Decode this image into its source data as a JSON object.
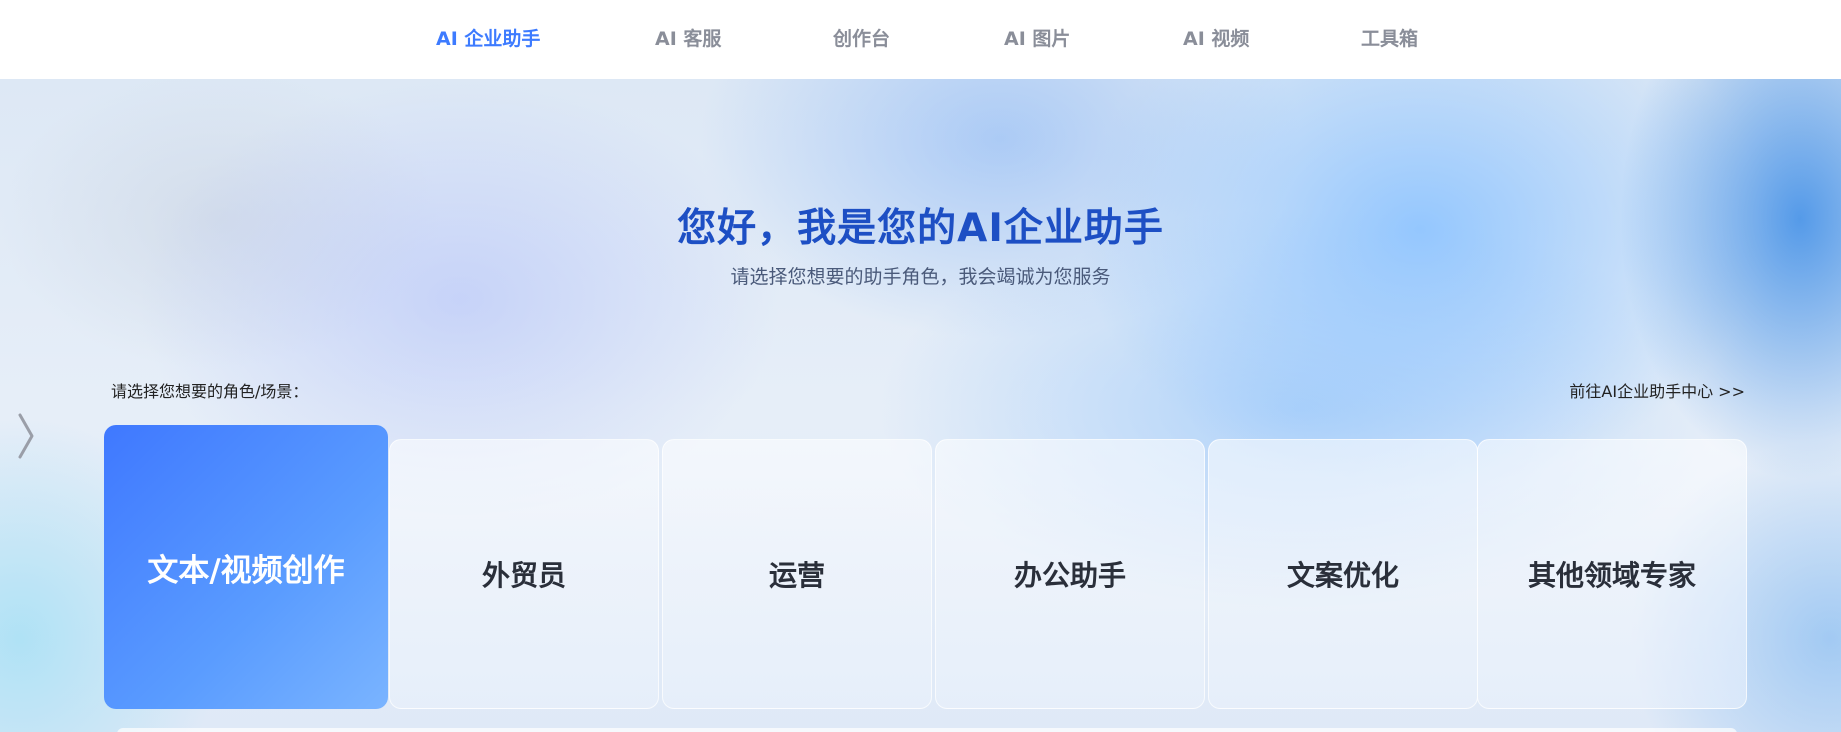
{
  "nav": {
    "items": [
      {
        "label": "AI 企业助手",
        "active": true
      },
      {
        "label": "AI 客服",
        "active": false
      },
      {
        "label": "创作台",
        "active": false
      },
      {
        "label": "AI 图片",
        "active": false
      },
      {
        "label": "AI 视频",
        "active": false
      },
      {
        "label": "工具箱",
        "active": false
      }
    ],
    "active_color": "#3d7bff",
    "inactive_color": "#8a8e99"
  },
  "hero": {
    "title": "您好，我是您的AI企业助手",
    "subtitle": "请选择您想要的助手角色，我会竭诚为您服务"
  },
  "roles": {
    "label": "请选择您想要的角色/场景：",
    "center_link": "前往AI企业助手中心 >>",
    "arrow_icon": "chevron-right-icon",
    "cards": [
      {
        "label": "文本/视频创作",
        "active": true
      },
      {
        "label": "外贸员",
        "active": false
      },
      {
        "label": "运营",
        "active": false
      },
      {
        "label": "办公助手",
        "active": false
      },
      {
        "label": "文案优化",
        "active": false
      },
      {
        "label": "其他领域专家",
        "active": false
      }
    ]
  },
  "colors": {
    "title_blue": "#1d4fc4",
    "card_active_start": "#3f78ff",
    "card_active_end": "#7ab4ff"
  }
}
